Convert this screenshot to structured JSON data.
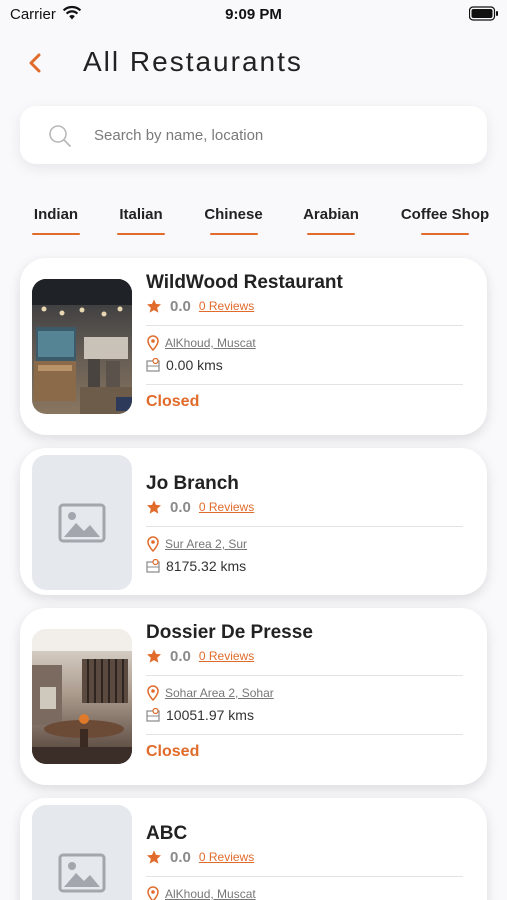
{
  "status_bar": {
    "carrier": "Carrier",
    "time": "9:09 PM"
  },
  "header": {
    "title": "All Restaurants"
  },
  "search": {
    "placeholder": "Search by name, location"
  },
  "tabs": [
    {
      "label": "Indian"
    },
    {
      "label": "Italian"
    },
    {
      "label": "Chinese"
    },
    {
      "label": "Arabian"
    },
    {
      "label": "Coffee Shop"
    }
  ],
  "restaurants": [
    {
      "name": "WildWood Restaurant",
      "rating": "0.0",
      "reviews": "0 Reviews",
      "location": "AlKhoud, Muscat",
      "distance": "0.00 kms",
      "status": "Closed",
      "image": "restaurant-interior-photo"
    },
    {
      "name": "Jo Branch",
      "rating": "0.0",
      "reviews": "0 Reviews",
      "location": "Sur Area 2, Sur",
      "distance": "8175.32 kms",
      "status": "",
      "image": "placeholder"
    },
    {
      "name": "Dossier De Presse",
      "rating": "0.0",
      "reviews": "0 Reviews",
      "location": "Sohar Area 2, Sohar",
      "distance": "10051.97 kms",
      "status": "Closed",
      "image": "lounge-interior-photo"
    },
    {
      "name": "ABC",
      "rating": "0.0",
      "reviews": "0 Reviews",
      "location": "AlKhoud, Muscat",
      "distance": "",
      "status": "",
      "image": "placeholder"
    }
  ],
  "colors": {
    "accent": "#e06b2b",
    "background": "#f9f9fb",
    "card": "#ffffff",
    "placeholder": "#e5e8ec"
  }
}
